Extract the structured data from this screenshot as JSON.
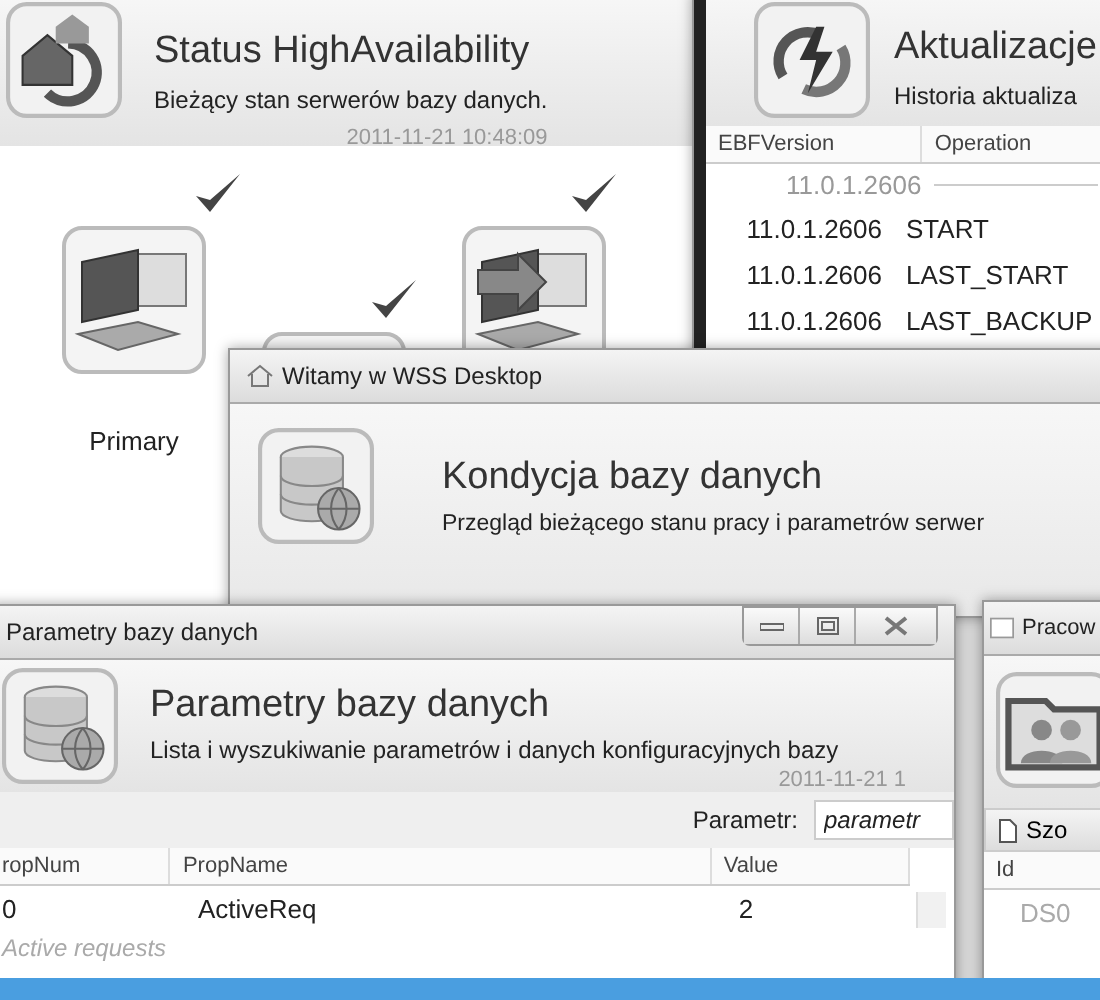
{
  "windows": [
    {
      "kind": "status",
      "title": "Status HighAvailability",
      "subtitle": "Bieżący stan serwerów bazy danych.",
      "timestamp": "2011-11-21 10:48:09",
      "servers": [
        {
          "label": "Primary",
          "checked": true,
          "arrow": false
        },
        {
          "checked": true
        },
        {
          "checked": true,
          "arrow": true
        }
      ]
    },
    {
      "kind": "updates",
      "title": "Aktualizacje",
      "subtitle": "Historia aktualiza",
      "columns": [
        "EBFVersion",
        "Operation"
      ],
      "group": "11.0.1.2606",
      "rows": [
        {
          "version": "11.0.1.2606",
          "operation": "START"
        },
        {
          "version": "11.0.1.2606",
          "operation": "LAST_START"
        },
        {
          "version": "11.0.1.2606",
          "operation": "LAST_BACKUP"
        }
      ]
    },
    {
      "kind": "welcome",
      "window_title": "Witamy w WSS Desktop",
      "title": "Kondycja bazy danych",
      "subtitle": "Przegląd bieżącego stanu pracy i parametrów serwer"
    },
    {
      "kind": "params",
      "window_title": "Parametry bazy danych",
      "title": "Parametry bazy danych",
      "subtitle": "Lista i wyszukiwanie parametrów i danych konfiguracyjnych bazy",
      "timestamp": "2011-11-21 1",
      "filter": {
        "label": "Parametr:",
        "placeholder": "parametr"
      },
      "columns": [
        "ropNum",
        "PropName",
        "Value"
      ],
      "rows": [
        {
          "cells": [
            "0",
            "ActiveReq",
            "2"
          ],
          "description": "Active requests"
        }
      ]
    },
    {
      "kind": "workspace",
      "window_title": "Pracow",
      "toolbar_button": "Szo",
      "columns": [
        "Id"
      ],
      "rows": [
        "DS0"
      ]
    }
  ]
}
